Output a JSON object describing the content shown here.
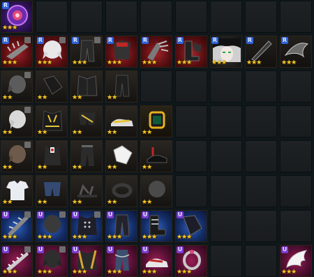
{
  "inventory": {
    "stars_glyph": "★★★",
    "badge_rare": "R",
    "badge_ultra": "U",
    "rows": [
      [
        {
          "icon": "purple-medallion-icon",
          "rarity": "purple",
          "badge": "R",
          "stars": 3,
          "lock": false
        }
      ],
      [
        {
          "icon": "spiked-gauntlet-icon",
          "rarity": "red",
          "badge": "R",
          "stars": 3,
          "lock": true
        },
        {
          "icon": "white-hair-icon",
          "rarity": "red",
          "badge": "R",
          "stars": 3,
          "lock": true
        },
        {
          "icon": "black-pants-icon",
          "rarity": "dark",
          "badge": "R",
          "stars": 3,
          "lock": true
        },
        {
          "icon": "red-armor-icon",
          "rarity": "red",
          "badge": "R",
          "stars": 3,
          "lock": false
        },
        {
          "icon": "metal-claw-icon",
          "rarity": "red",
          "badge": "R",
          "stars": 3,
          "lock": false
        },
        {
          "icon": "black-boots-icon",
          "rarity": "red",
          "badge": "R",
          "stars": 3,
          "lock": false
        },
        {
          "icon": "character-face-icon",
          "rarity": "bw",
          "badge": "R",
          "stars": 3,
          "lock": false
        },
        {
          "icon": "dark-blade-icon",
          "rarity": "black",
          "badge": "R",
          "stars": 3,
          "lock": false
        },
        {
          "icon": "steel-wing-icon",
          "rarity": "black",
          "badge": "R",
          "stars": 3,
          "lock": false
        }
      ],
      [
        {
          "icon": "gray-hair-icon",
          "rarity": "dark",
          "badge": "",
          "stars": 2,
          "lock": true
        },
        {
          "icon": "black-gloves-icon",
          "rarity": "dark",
          "badge": "",
          "stars": 2,
          "lock": false
        },
        {
          "icon": "black-jacket-icon",
          "rarity": "dark",
          "badge": "",
          "stars": 2,
          "lock": false
        },
        {
          "icon": "dark-pants-icon",
          "rarity": "dark",
          "badge": "",
          "stars": 2,
          "lock": false
        }
      ],
      [
        {
          "icon": "silver-hair-icon",
          "rarity": "dark",
          "badge": "",
          "stars": 2,
          "lock": true
        },
        {
          "icon": "yellow-jacket-icon",
          "rarity": "dark",
          "badge": "",
          "stars": 2,
          "lock": false
        },
        {
          "icon": "shorts-icon",
          "rarity": "dark",
          "badge": "",
          "stars": 2,
          "lock": false
        },
        {
          "icon": "sneakers-icon",
          "rarity": "dark",
          "badge": "",
          "stars": 2,
          "lock": false
        },
        {
          "icon": "wristwatch-icon",
          "rarity": "gold",
          "badge": "",
          "stars": 2,
          "lock": false
        }
      ],
      [
        {
          "icon": "brown-hair-icon",
          "rarity": "dark",
          "badge": "",
          "stars": 2,
          "lock": true
        },
        {
          "icon": "formal-vest-icon",
          "rarity": "dark",
          "badge": "",
          "stars": 2,
          "lock": false
        },
        {
          "icon": "slacks-icon",
          "rarity": "dark",
          "badge": "",
          "stars": 2,
          "lock": false
        },
        {
          "icon": "white-gloves-icon",
          "rarity": "dark",
          "badge": "",
          "stars": 2,
          "lock": false
        },
        {
          "icon": "dress-shoes-icon",
          "rarity": "dark",
          "badge": "",
          "stars": 2,
          "lock": false
        }
      ],
      [
        {
          "icon": "white-shirt-icon",
          "rarity": "dark",
          "badge": "",
          "stars": 2,
          "lock": false
        },
        {
          "icon": "blue-shorts-icon",
          "rarity": "dark",
          "badge": "",
          "stars": 2,
          "lock": false
        },
        {
          "icon": "sandals-icon",
          "rarity": "dark",
          "badge": "",
          "stars": 2,
          "lock": false
        },
        {
          "icon": "bracelet-icon",
          "rarity": "dark",
          "badge": "",
          "stars": 2,
          "lock": false
        },
        {
          "icon": "short-hair-icon",
          "rarity": "dark",
          "badge": "",
          "stars": 2,
          "lock": false
        }
      ],
      [
        {
          "icon": "spiked-sword-icon",
          "rarity": "blue",
          "badge": "U",
          "stars": 3,
          "lock": true
        },
        {
          "icon": "dark-hair-icon",
          "rarity": "blue",
          "badge": "U",
          "stars": 3,
          "lock": true
        },
        {
          "icon": "military-coat-icon",
          "rarity": "blue",
          "badge": "U",
          "stars": 3,
          "lock": true
        },
        {
          "icon": "cargo-pants-icon",
          "rarity": "blue",
          "badge": "U",
          "stars": 3,
          "lock": false
        },
        {
          "icon": "buckle-boots-icon",
          "rarity": "blue",
          "badge": "U",
          "stars": 3,
          "lock": false
        },
        {
          "icon": "gauntlet-icon",
          "rarity": "blue",
          "badge": "U",
          "stars": 3,
          "lock": false
        }
      ],
      [
        {
          "icon": "serrated-blade-icon",
          "rarity": "crimson",
          "badge": "U",
          "stars": 3,
          "lock": true
        },
        {
          "icon": "black-hair-icon",
          "rarity": "crimson",
          "badge": "U",
          "stars": 3,
          "lock": true
        },
        {
          "icon": "gold-jacket-icon",
          "rarity": "crimson",
          "badge": "U",
          "stars": 3,
          "lock": false
        },
        {
          "icon": "chain-jeans-icon",
          "rarity": "crimson",
          "badge": "U",
          "stars": 3,
          "lock": false
        },
        {
          "icon": "red-sneakers-icon",
          "rarity": "crimson",
          "badge": "U",
          "stars": 3,
          "lock": false
        },
        {
          "icon": "ring-icon",
          "rarity": "crimson",
          "badge": "U",
          "stars": 3,
          "lock": false
        },
        null,
        null,
        {
          "icon": "angel-wing-icon",
          "rarity": "crimson",
          "badge": "U",
          "stars": 3,
          "lock": false
        }
      ]
    ]
  }
}
